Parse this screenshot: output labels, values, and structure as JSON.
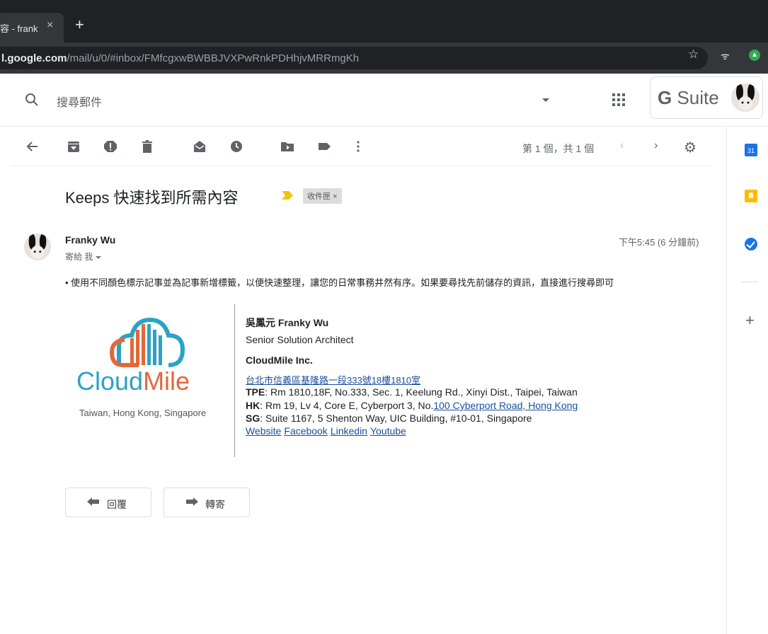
{
  "browser": {
    "tab_title": "容 - frank",
    "url_host": "l.google.com",
    "url_path": "/mail/u/0/#inbox/FMfcgxwBWBBJVXPwRnkPDHhjvMRRmgKh"
  },
  "header": {
    "search_placeholder": "搜尋郵件",
    "brand_g": "G",
    "brand_suite": " Suite"
  },
  "toolbar": {
    "page_count": "第 1 個，共 1 個"
  },
  "email": {
    "subject": "Keeps 快速找到所需內容",
    "label": "收件匣",
    "sender": "Franky Wu",
    "to": "寄給 我",
    "time": "下午5:45 (6 分鐘前)",
    "body": "• 使用不同顏色標示記事並為記事新增標籤，以便快速整理，讓您的日常事務井然有序。如果要尋找先前儲存的資訊，直接進行搜尋即可"
  },
  "signature": {
    "logo_cloud": "Cloud",
    "logo_mile": "Mile",
    "regions": "Taiwan, Hong Kong, Singapore",
    "name": "吳鳳元 Franky Wu",
    "title": "Senior Solution Architect",
    "company": "CloudMile Inc.",
    "address_zh": "台北市信義區基隆路一段333號18樓1810室",
    "tpe_label": "TPE",
    "tpe_addr": ": Rm 1810,18F, No.333, Sec. 1, Keelung Rd., Xinyi Dist., Taipei, Taiwan",
    "hk_label": "HK",
    "hk_addr": ": Rm 19, Lv 4, Core E, Cyberport 3, No.",
    "hk_link": "100 Cyberport Road, Hong Kong",
    "sg_label": "SG",
    "sg_addr": ": Suite 1167, 5 Shenton Way, UIC Building, #10-01, Singapore",
    "links": [
      "Website",
      "Facebook",
      "Linkedin",
      "Youtube"
    ]
  },
  "actions": {
    "reply": "回覆",
    "forward": "轉寄"
  },
  "rail": {
    "calendar_day": "31"
  }
}
